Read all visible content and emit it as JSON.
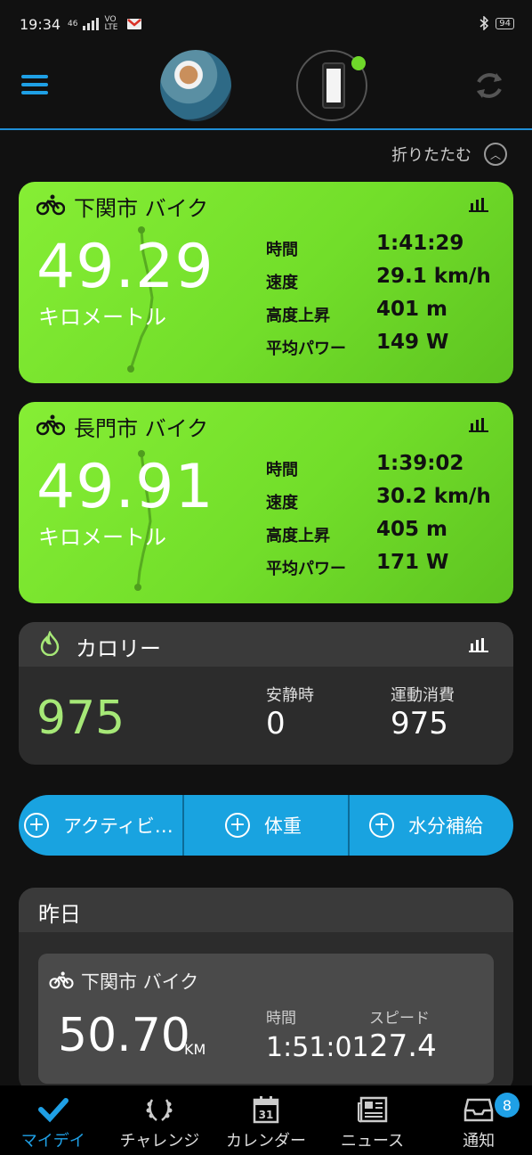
{
  "status_bar": {
    "time": "19:34",
    "network": "46",
    "volte": "VO LTE",
    "battery": "94"
  },
  "header": {
    "collapse_label": "折りたたむ"
  },
  "activities": [
    {
      "title": "下関市 バイク",
      "distance": "49.29",
      "distance_unit": "キロメートル",
      "stats": [
        {
          "label": "時間",
          "value": "1:41:29"
        },
        {
          "label": "速度",
          "value": "29.1 km/h"
        },
        {
          "label": "高度上昇",
          "value": "401 m"
        },
        {
          "label": "平均パワー",
          "value": "149 W"
        }
      ]
    },
    {
      "title": "長門市 バイク",
      "distance": "49.91",
      "distance_unit": "キロメートル",
      "stats": [
        {
          "label": "時間",
          "value": "1:39:02"
        },
        {
          "label": "速度",
          "value": "30.2 km/h"
        },
        {
          "label": "高度上昇",
          "value": "405 m"
        },
        {
          "label": "平均パワー",
          "value": "171 W"
        }
      ]
    }
  ],
  "calories": {
    "title": "カロリー",
    "total": "975",
    "resting_label": "安静時",
    "resting_value": "0",
    "active_label": "運動消費",
    "active_value": "975"
  },
  "actions": [
    {
      "label": "アクティビ…"
    },
    {
      "label": "体重"
    },
    {
      "label": "水分補給"
    }
  ],
  "yesterday": {
    "header": "昨日",
    "title": "下関市 バイク",
    "distance": "50.70",
    "unit": "KM",
    "time_label": "時間",
    "time_value": "1:51:01",
    "speed_label": "スピード",
    "speed_value": "27.4"
  },
  "bottom_nav": [
    {
      "label": "マイデイ",
      "icon": "checkmark-icon"
    },
    {
      "label": "チャレンジ",
      "icon": "laurel-icon"
    },
    {
      "label": "カレンダー",
      "icon": "calendar-icon",
      "calendar_day": "31"
    },
    {
      "label": "ニュース",
      "icon": "newspaper-icon"
    },
    {
      "label": "通知",
      "icon": "inbox-icon",
      "badge": "8"
    }
  ],
  "colors": {
    "accent": "#1fa0e6",
    "card_green": "#78e22d",
    "calorie_value": "#a6e877",
    "device_status": "#6fd82a"
  }
}
